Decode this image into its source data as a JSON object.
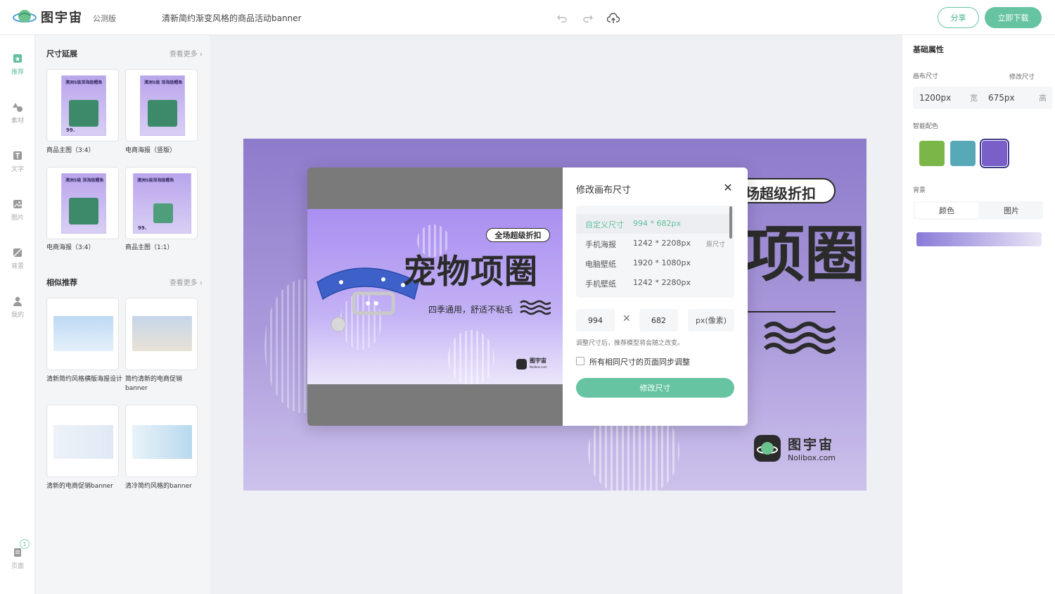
{
  "app": {
    "logo_text": "图宇宙",
    "beta_label": "公测版",
    "doc_title": "清新简约渐变风格的商品活动banner",
    "share_label": "分享",
    "download_label": "立即下载",
    "icons": [
      "undo-icon",
      "redo-icon",
      "cloud-save-icon"
    ]
  },
  "nav": {
    "items": [
      {
        "label": "推荐",
        "icon": "recommend-icon",
        "active": true
      },
      {
        "label": "素材",
        "icon": "shapes-icon"
      },
      {
        "label": "文字",
        "icon": "text-icon"
      },
      {
        "label": "图片",
        "icon": "image-icon"
      },
      {
        "label": "背景",
        "icon": "background-icon"
      },
      {
        "label": "我的",
        "icon": "user-icon"
      }
    ],
    "pages_label": "页面",
    "pages_count": "1"
  },
  "templates": {
    "size_section_title": "尺寸延展",
    "similar_section_title": "相似推荐",
    "more_label": "查看更多",
    "size_cards": [
      {
        "label": "商品主图（3:4）",
        "thumb_text": "澳洲S级深海级鳕鱼",
        "price": "99."
      },
      {
        "label": "电商海报（竖版）",
        "thumb_text": "澳洲S级 深海级鳕鱼",
        "price": ""
      },
      {
        "label": "电商海报（3:4）",
        "thumb_text": "澳洲S级 深海级鳕鱼",
        "price": ""
      },
      {
        "label": "商品主图（1:1）",
        "thumb_text": "澳洲S级深海级鳕鱼",
        "price": "99."
      }
    ],
    "similar_cards": [
      {
        "label": "清新简约风格横版海报设计"
      },
      {
        "label": "简约清新的电商促销banner"
      },
      {
        "label": "清新的电商促销banner"
      },
      {
        "label": "清冷简约风格的banner"
      }
    ]
  },
  "right_panel": {
    "title": "基础属性",
    "canvas_size_label": "画布尺寸",
    "edit_size_label": "修改尺寸",
    "width_value": "1200px",
    "width_unit": "宽",
    "height_value": "675px",
    "height_unit": "高",
    "smart_color_label": "智能配色",
    "swatches": [
      "#7ab648",
      "#58a9b8",
      "#7b5fc9"
    ],
    "background_label": "背景",
    "bg_tab_color": "颜色",
    "bg_tab_image": "图片"
  },
  "canvas": {
    "badge_text": "场超级折扣",
    "big_text": "项圈",
    "logo_cn": "图宇宙",
    "logo_en": "Nolibox.com"
  },
  "modal": {
    "title": "修改画布尺寸",
    "size_options": [
      {
        "name": "自定义尺寸",
        "value": "994 * 682px",
        "tag": "",
        "selected": true
      },
      {
        "name": "手机海报",
        "value": "1242 * 2208px",
        "tag": "原尺寸"
      },
      {
        "name": "电脑壁纸",
        "value": "1920 * 1080px",
        "tag": ""
      },
      {
        "name": "手机壁纸",
        "value": "1242 * 2280px",
        "tag": ""
      }
    ],
    "width_input": "994",
    "height_input": "682",
    "unit_label": "px(像素)",
    "hint": "调整尺寸后，推荐模型将会随之改变。",
    "sync_label": "所有相同尺寸的页面同步调整",
    "apply_label": "修改尺寸",
    "preview": {
      "badge": "全场超级折扣",
      "big_text": "宠物项圈",
      "subtitle": "四季通用，舒适不粘毛",
      "logo_cn": "图宇宙",
      "logo_en": "Nolibox.com"
    }
  }
}
